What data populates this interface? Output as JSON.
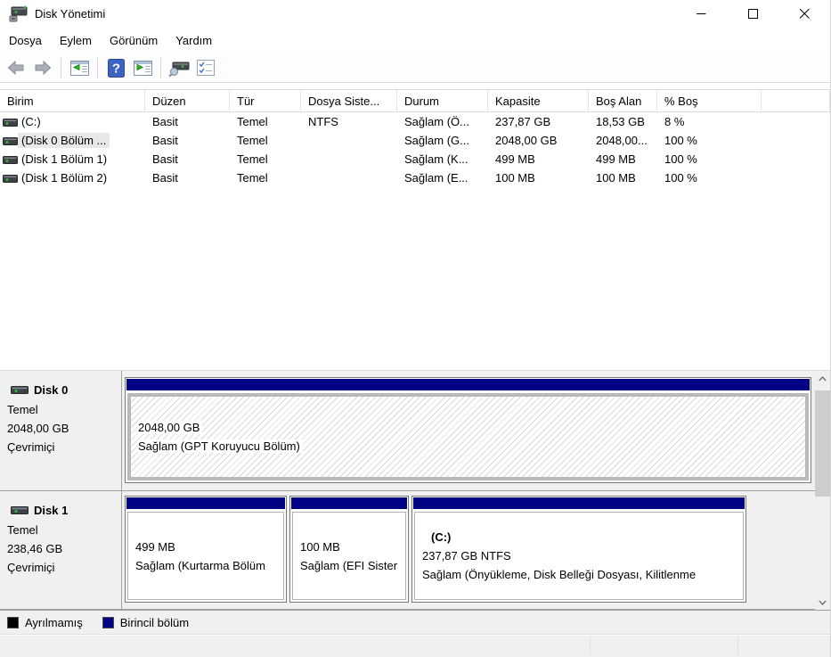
{
  "window": {
    "title": "Disk Yönetimi"
  },
  "menu": {
    "items": [
      "Dosya",
      "Eylem",
      "Görünüm",
      "Yardım"
    ]
  },
  "toolbar": {
    "icons": [
      "back-icon",
      "forward-icon",
      "show-console-tree-icon",
      "help-icon",
      "show-action-pane-icon",
      "rescan-disks-icon",
      "checklist-icon"
    ]
  },
  "table": {
    "columns": [
      "Birim",
      "Düzen",
      "Tür",
      "Dosya Siste...",
      "Durum",
      "Kapasite",
      "Boş Alan",
      "% Boş"
    ],
    "rows": [
      {
        "volume": "(C:)",
        "layout": "Basit",
        "type": "Temel",
        "fs": "NTFS",
        "status": "Sağlam (Ö...",
        "capacity": "237,87 GB",
        "free": "18,53 GB",
        "pct_free": "8 %",
        "selected": false
      },
      {
        "volume": "(Disk 0 Bölüm ...",
        "layout": "Basit",
        "type": "Temel",
        "fs": "",
        "status": "Sağlam (G...",
        "capacity": "2048,00 GB",
        "free": "2048,00...",
        "pct_free": "100 %",
        "selected": true
      },
      {
        "volume": "(Disk 1 Bölüm 1)",
        "layout": "Basit",
        "type": "Temel",
        "fs": "",
        "status": "Sağlam (K...",
        "capacity": "499 MB",
        "free": "499 MB",
        "pct_free": "100 %",
        "selected": false
      },
      {
        "volume": "(Disk 1 Bölüm 2)",
        "layout": "Basit",
        "type": "Temel",
        "fs": "",
        "status": "Sağlam (E...",
        "capacity": "100 MB",
        "free": "100 MB",
        "pct_free": "100 %",
        "selected": false
      }
    ]
  },
  "disks": [
    {
      "name": "Disk 0",
      "kind": "Temel",
      "size": "2048,00 GB",
      "state": "Çevrimiçi",
      "partitions": [
        {
          "size": "2048,00 GB",
          "status": "Sağlam (GPT Koruyucu Bölüm)",
          "selected": true
        }
      ]
    },
    {
      "name": "Disk 1",
      "kind": "Temel",
      "size": "238,46 GB",
      "state": "Çevrimiçi",
      "partitions": [
        {
          "size": "499 MB",
          "status": "Sağlam (Kurtarma Bölüm",
          "selected": false
        },
        {
          "size": "100 MB",
          "status": "Sağlam (EFI Sister",
          "selected": false
        },
        {
          "label": "(C:)",
          "size": "237,87 GB NTFS",
          "status": "Sağlam (Önyükleme, Disk Belleği Dosyası, Kilitlenme",
          "selected": false
        }
      ]
    }
  ],
  "legend": {
    "items": [
      {
        "label": "Ayrılmamış",
        "color": "#000000"
      },
      {
        "label": "Birincil bölüm",
        "color": "#020284"
      }
    ]
  },
  "colors": {
    "primary_partition": "#020284",
    "unallocated": "#000000"
  }
}
